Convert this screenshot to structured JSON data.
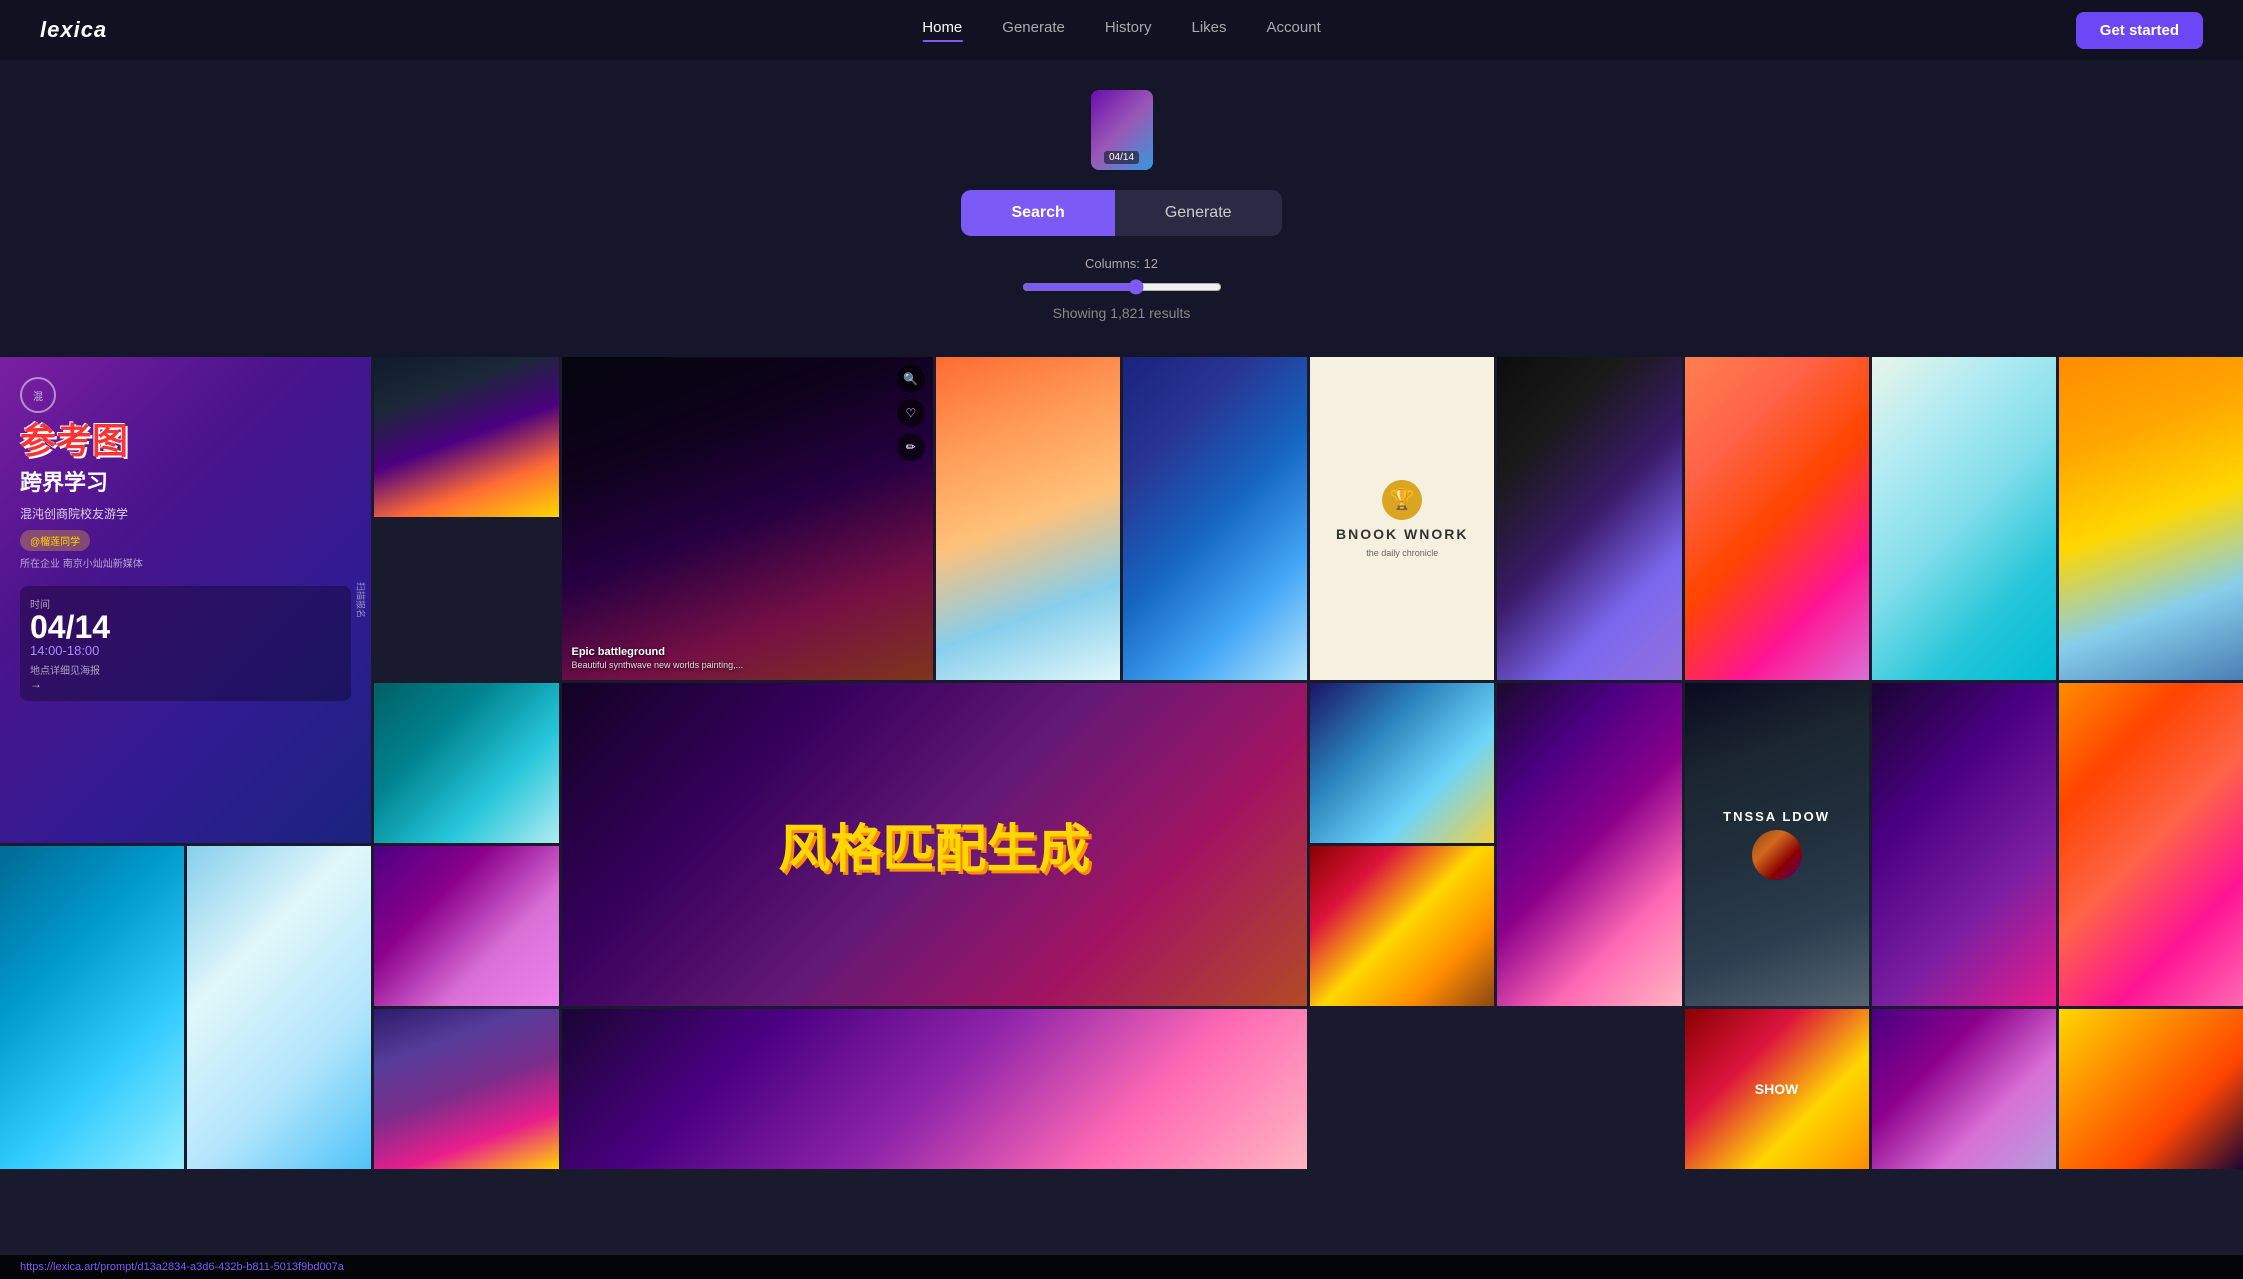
{
  "nav": {
    "logo": "lexica",
    "links": [
      {
        "label": "Home",
        "active": true
      },
      {
        "label": "Generate",
        "active": false
      },
      {
        "label": "History",
        "active": false
      },
      {
        "label": "Likes",
        "active": false
      },
      {
        "label": "Account",
        "active": false
      }
    ],
    "cta_label": "Get started"
  },
  "hero": {
    "thumbnail": {
      "label": "04/14"
    },
    "search_label": "Search",
    "generate_label": "Generate",
    "columns_label": "Columns: 12",
    "results_label": "Showing 1,821 results"
  },
  "gallery": {
    "featured_left": {
      "circle_label": "混",
      "title": "参考图",
      "subtitle_1": "跨界学习",
      "subtitle_2": "混沌创商院校友游学",
      "person_label": "@榴莲同学",
      "role_label": "所在企业 南京小灿灿新媒体",
      "time_label": "时间",
      "date": "04/14",
      "time_range": "14:00-18:00",
      "location": "地点详细见海报",
      "side_label": "扫描报名"
    },
    "hovered_item": {
      "title": "Epic battleground",
      "description": "Beautiful synthwave new worlds painting,..."
    },
    "chinese_overlay": "风格匹配生成",
    "results_count": "Showing 1,821 results",
    "book_item": {
      "title": "BNOOK WNORK",
      "subtitle": "the daily chronicle"
    },
    "tnssa_text": "TNSSA LDOW",
    "status_url": "https://lexica.art/prompt/d13a2834-a3d6-432b-b811-5013f9bd007a"
  }
}
